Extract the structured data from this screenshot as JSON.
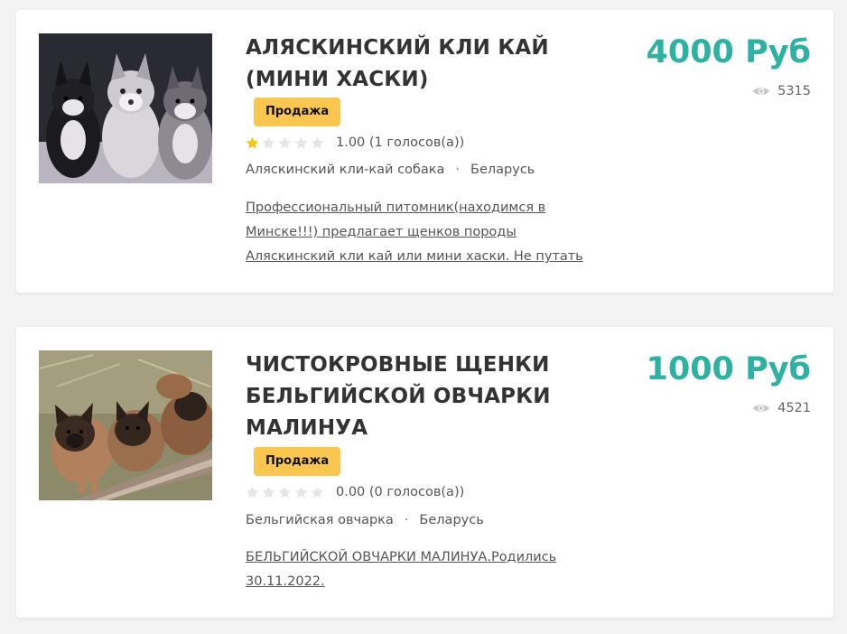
{
  "listings": [
    {
      "title": "АЛЯСКИНСКИЙ КЛИ КАЙ (МИНИ ХАСКИ)",
      "badge": "Продажа",
      "rating": 1,
      "rating_max": 5,
      "rating_text": "1.00 (1 голосов(а))",
      "breed": "Аляскинский кли-кай собака",
      "separator": "·",
      "country": "Беларусь",
      "description": "Профессиональный питомник(находимся в Минске!!!) предлагает щенков породы Аляскинский кли кай или мини хаски. Не путать",
      "price": "4000 Руб",
      "views": "5315"
    },
    {
      "title": "ЧИСТОКРОВНЫЕ ЩЕНКИ БЕЛЬГИЙСКОЙ ОВЧАРКИ МАЛИНУА",
      "badge": "Продажа",
      "rating": 0,
      "rating_max": 5,
      "rating_text": "0.00 (0 голосов(а))",
      "breed": "Бельгийская овчарка",
      "separator": "·",
      "country": "Беларусь",
      "description": "БЕЛЬГИЙСКОЙ ОВЧАРКИ МАЛИНУА.Родились 30.11.2022.",
      "price": "1000 Руб",
      "views": "4521"
    }
  ],
  "colors": {
    "price": "#2db1a0",
    "badge": "#f9c74f",
    "star_active": "#f5c518",
    "star_inactive": "#e6e6e6",
    "eye_icon": "#c8c8c8"
  },
  "icons": {
    "star": "star-icon",
    "views": "eye-icon"
  }
}
